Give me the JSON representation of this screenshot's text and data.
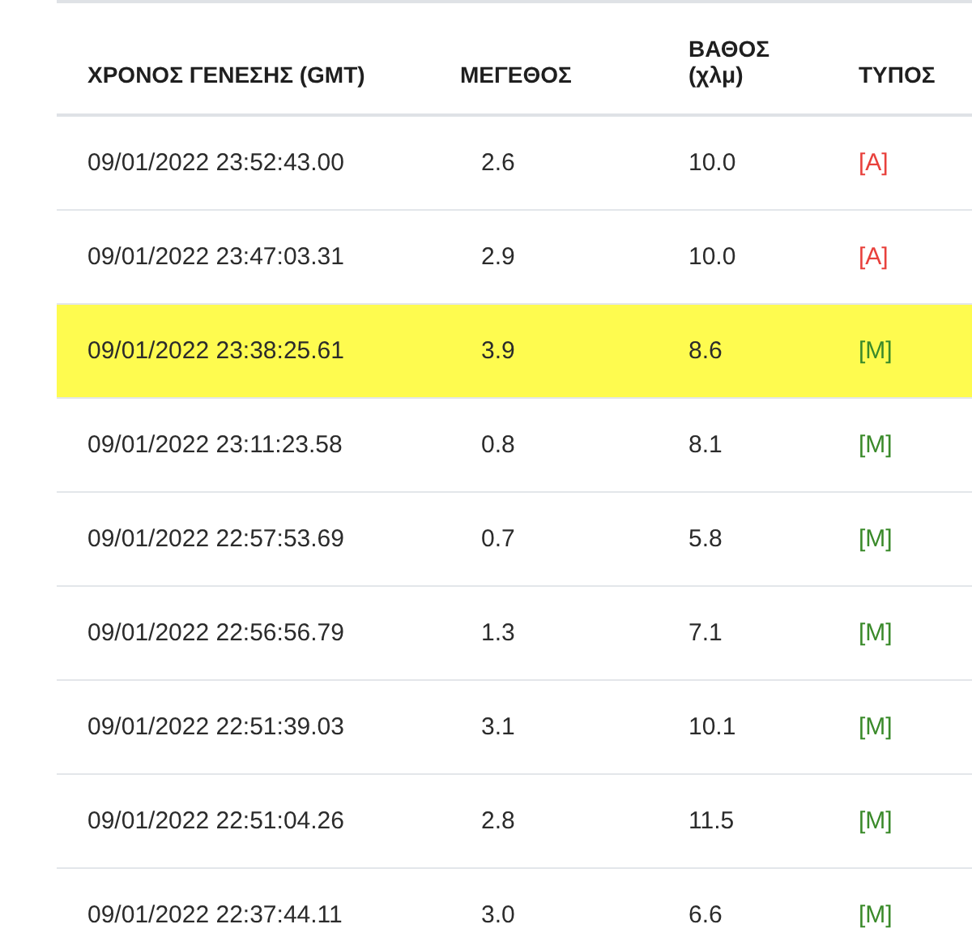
{
  "table": {
    "columns": [
      {
        "label": "ΧΡΟΝΟΣ ΓΕΝΕΣΗΣ (GMT)"
      },
      {
        "label": "ΜΕΓΕΘΟΣ"
      },
      {
        "label": "ΒΑΘΟΣ (χλμ)"
      },
      {
        "label": "ΤΥΠΟΣ"
      }
    ],
    "rows": [
      {
        "time": "09/01/2022 23:52:43.00",
        "magnitude": "2.6",
        "depth": "10.0",
        "type": "[A]",
        "color": "#e8413c",
        "highlighted": false
      },
      {
        "time": "09/01/2022 23:47:03.31",
        "magnitude": "2.9",
        "depth": "10.0",
        "type": "[A]",
        "color": "#e8413c",
        "highlighted": false
      },
      {
        "time": "09/01/2022 23:38:25.61",
        "magnitude": "3.9",
        "depth": "8.6",
        "type": "[M]",
        "color": "#3a8a2a",
        "highlighted": true
      },
      {
        "time": "09/01/2022 23:11:23.58",
        "magnitude": "0.8",
        "depth": "8.1",
        "type": "[M]",
        "color": "#3a8a2a",
        "highlighted": false
      },
      {
        "time": "09/01/2022 22:57:53.69",
        "magnitude": "0.7",
        "depth": "5.8",
        "type": "[M]",
        "color": "#3a8a2a",
        "highlighted": false
      },
      {
        "time": "09/01/2022 22:56:56.79",
        "magnitude": "1.3",
        "depth": "7.1",
        "type": "[M]",
        "color": "#3a8a2a",
        "highlighted": false
      },
      {
        "time": "09/01/2022 22:51:39.03",
        "magnitude": "3.1",
        "depth": "10.1",
        "type": "[M]",
        "color": "#3a8a2a",
        "highlighted": false
      },
      {
        "time": "09/01/2022 22:51:04.26",
        "magnitude": "2.8",
        "depth": "11.5",
        "type": "[M]",
        "color": "#3a8a2a",
        "highlighted": false
      },
      {
        "time": "09/01/2022 22:37:44.11",
        "magnitude": "3.0",
        "depth": "6.6",
        "type": "[M]",
        "color": "#3a8a2a",
        "highlighted": false
      }
    ]
  }
}
